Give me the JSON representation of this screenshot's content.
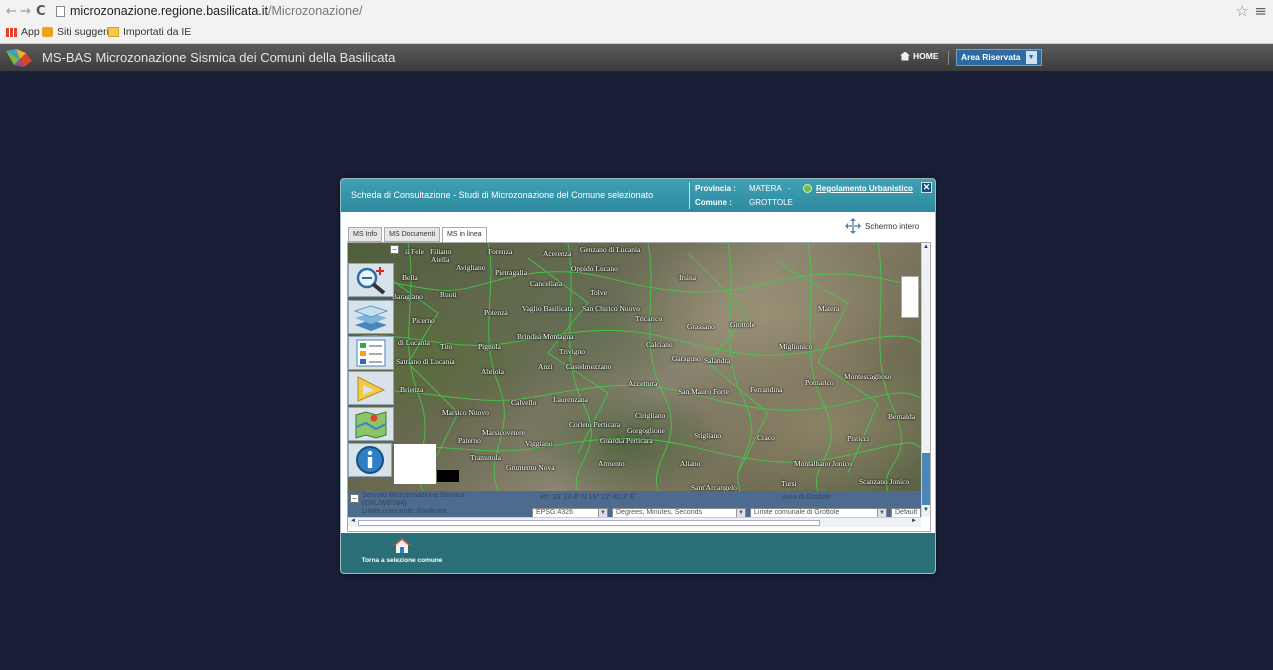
{
  "browser": {
    "url_host": "microzonazione.regione.basilicata.it",
    "url_path": "/Microzonazione/",
    "bookmarks": [
      {
        "label": "App"
      },
      {
        "label": "Siti suggeriti"
      },
      {
        "label": "Importati da IE"
      }
    ]
  },
  "header": {
    "title": "MS-BAS Microzonazione Sismica dei Comuni della Basilicata",
    "home_label": "HOME",
    "area_label": "Area Riservata"
  },
  "dialog": {
    "title": "Scheda di Consultazione - Studi di Microzonazione del Comune selezionato",
    "provincia_label": "Provincia :",
    "provincia_value": "MATERA",
    "comune_label": "Comune :",
    "comune_value": "GROTTOLE",
    "separator": "-",
    "regolamento_label": "Regolamento Urbanistico",
    "close_label": "✕",
    "tabs": [
      "MS Info",
      "MS Documenti",
      "MS in linea"
    ],
    "active_tab": "MS in linea",
    "fullscreen_label": "Schermo intero",
    "footer_button_label": "Torna a selezione comune"
  },
  "map": {
    "towns": [
      {
        "name": "Filiano"
      },
      {
        "name": "Atella"
      },
      {
        "name": "Forenza"
      },
      {
        "name": "Acerenza"
      },
      {
        "name": "Genzano di Lucania"
      },
      {
        "name": "Avigliano"
      },
      {
        "name": "Pietragalla"
      },
      {
        "name": "Oppido Lucano"
      },
      {
        "name": "Bella"
      },
      {
        "name": "Cancellara"
      },
      {
        "name": "Irsina"
      },
      {
        "name": "Baragiano"
      },
      {
        "name": "Ruoti"
      },
      {
        "name": "Tolve"
      },
      {
        "name": "Potenza"
      },
      {
        "name": "Vaglio Basilicata"
      },
      {
        "name": "San Chirico Nuovo"
      },
      {
        "name": "Matera"
      },
      {
        "name": "Picerno"
      },
      {
        "name": "Tricarico"
      },
      {
        "name": "Grassano"
      },
      {
        "name": "Grottole"
      },
      {
        "name": "Brindisi Montagna"
      },
      {
        "name": "di Lucania"
      },
      {
        "name": "Tito"
      },
      {
        "name": "Pignola"
      },
      {
        "name": "Trivigno"
      },
      {
        "name": "Calciano"
      },
      {
        "name": "Miglionico"
      },
      {
        "name": "Satriano di Lucania"
      },
      {
        "name": "Garaguso"
      },
      {
        "name": "Salandra"
      },
      {
        "name": "Anzi"
      },
      {
        "name": "Castelmezzano"
      },
      {
        "name": "Abriola"
      },
      {
        "name": "Pomarico"
      },
      {
        "name": "Montescaglioso"
      },
      {
        "name": "Accettura"
      },
      {
        "name": "Brienza"
      },
      {
        "name": "San Mauro Forte"
      },
      {
        "name": "Ferrandina"
      },
      {
        "name": "Laurenzana"
      },
      {
        "name": "Calvello"
      },
      {
        "name": "Marsico Nuovo"
      },
      {
        "name": "Cirigliano"
      },
      {
        "name": "Bernalda"
      },
      {
        "name": "Corleto Perticara"
      },
      {
        "name": "Gorgoglione"
      },
      {
        "name": "Marsicovetere"
      },
      {
        "name": "Stigliano"
      },
      {
        "name": "Craco"
      },
      {
        "name": "Pisticci"
      },
      {
        "name": "Paterno"
      },
      {
        "name": "Viggiano"
      },
      {
        "name": "Guardia Perticara"
      },
      {
        "name": "Tramutola"
      },
      {
        "name": "Armento"
      },
      {
        "name": "Aliano"
      },
      {
        "name": "Montalbano Jonico"
      },
      {
        "name": "Grumento Nova"
      },
      {
        "name": "Scanzano Jonico"
      },
      {
        "name": "Tursi"
      },
      {
        "name": "Sant'Arcangelo"
      },
      {
        "name": "ii Fele"
      }
    ],
    "status": {
      "line1": "Servizio Microzonazione Sismica",
      "line2": "(CPL/WGS84)",
      "line3": "Limite comunale: Basilicata",
      "coord": "40° 38' 23.4\" N   16° 22' 40.3\" E",
      "scale": "Area di Grottole"
    },
    "selects": {
      "epsg": "EPSG:4326",
      "units": "Degrees, Minutes, Seconds",
      "limit": "Limite comunale di Grottole",
      "default": "Default"
    }
  }
}
